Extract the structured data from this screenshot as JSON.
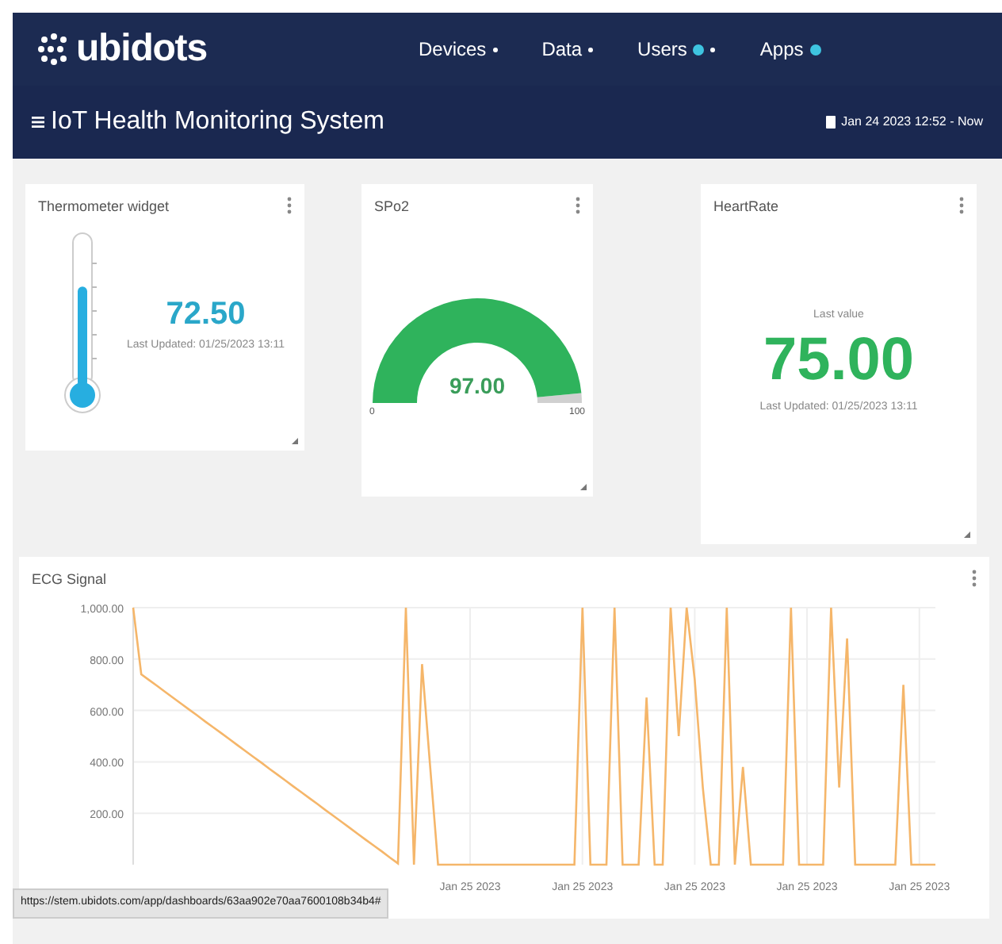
{
  "brand": {
    "name": "ubidots"
  },
  "nav": [
    {
      "label": "Devices",
      "dropdown": true,
      "dot": false
    },
    {
      "label": "Data",
      "dropdown": true,
      "dot": false
    },
    {
      "label": "Users",
      "dropdown": true,
      "dot": true
    },
    {
      "label": "Apps",
      "dropdown": false,
      "dot": true
    }
  ],
  "dashboard": {
    "title": "IoT Health Monitoring System",
    "date_range": "Jan 24 2023 12:52 - Now"
  },
  "thermometer": {
    "title": "Thermometer widget",
    "level": 0.7,
    "value": "72.50",
    "updated": "Last Updated: 01/25/2023 13:11"
  },
  "spo2": {
    "title": "SPo2",
    "level": 0.97,
    "value": "97.00",
    "min": "0",
    "max": "100"
  },
  "heart_rate": {
    "title": "HeartRate",
    "caption": "Last value",
    "value": "75.00",
    "updated": "Last Updated: 01/25/2023 13:11"
  },
  "ecg": {
    "title": "ECG Signal",
    "chart_data": {
      "type": "line",
      "categories": [
        null,
        null,
        null,
        null,
        null,
        null,
        null,
        null,
        null,
        null,
        null,
        null,
        null,
        null,
        null,
        null,
        null,
        null,
        null,
        null,
        null,
        null,
        null,
        null,
        null,
        null,
        null,
        null,
        null,
        null,
        null,
        null,
        null,
        null,
        null,
        null,
        null,
        null,
        null,
        null,
        null,
        null,
        "Jan 25 2023",
        null,
        null,
        null,
        null,
        null,
        null,
        null,
        null,
        null,
        null,
        null,
        null,
        null,
        "Jan 25 2023",
        null,
        null,
        null,
        null,
        null,
        null,
        null,
        null,
        null,
        null,
        null,
        null,
        null,
        "Jan 25 2023",
        null,
        null,
        null,
        null,
        null,
        null,
        null,
        null,
        null,
        null,
        null,
        null,
        null,
        "Jan 25 2023",
        null,
        null,
        null,
        null,
        null,
        null,
        null,
        null,
        null,
        null,
        null,
        null,
        null,
        "Jan 25 2023",
        null,
        null
      ],
      "series": [
        {
          "color": "#f5b66a",
          "values": [
            1000,
            741,
            718,
            695,
            672,
            649,
            626,
            603,
            580,
            557,
            534,
            511,
            488,
            465,
            442,
            419,
            396,
            373,
            350,
            327,
            304,
            281,
            258,
            235,
            212,
            189,
            166,
            143,
            120,
            97,
            74,
            51,
            28,
            5,
            1000,
            0,
            780,
            390,
            0,
            0,
            0,
            0,
            0,
            0,
            0,
            0,
            0,
            0,
            0,
            0,
            0,
            0,
            0,
            0,
            0,
            0,
            1000,
            0,
            0,
            0,
            1000,
            0,
            0,
            0,
            650,
            0,
            0,
            1000,
            500,
            1000,
            720,
            300,
            0,
            0,
            1000,
            0,
            380,
            0,
            0,
            0,
            0,
            0,
            1000,
            0,
            0,
            0,
            0,
            1000,
            300,
            880,
            0,
            0,
            0,
            0,
            0,
            0,
            700,
            0,
            0,
            0,
            0
          ]
        }
      ],
      "grid": true,
      "ylim": [
        0,
        1000
      ],
      "yticks": [
        {
          "value": 200,
          "label": "200.00"
        },
        {
          "value": 400,
          "label": "400.00"
        },
        {
          "value": 600,
          "label": "600.00"
        },
        {
          "value": 800,
          "label": "800.00"
        },
        {
          "value": 1000,
          "label": "1,000.00"
        }
      ]
    }
  },
  "status_url": "https://stem.ubidots.com/app/dashboards/63aa902e70aa7600108b34b4#"
}
